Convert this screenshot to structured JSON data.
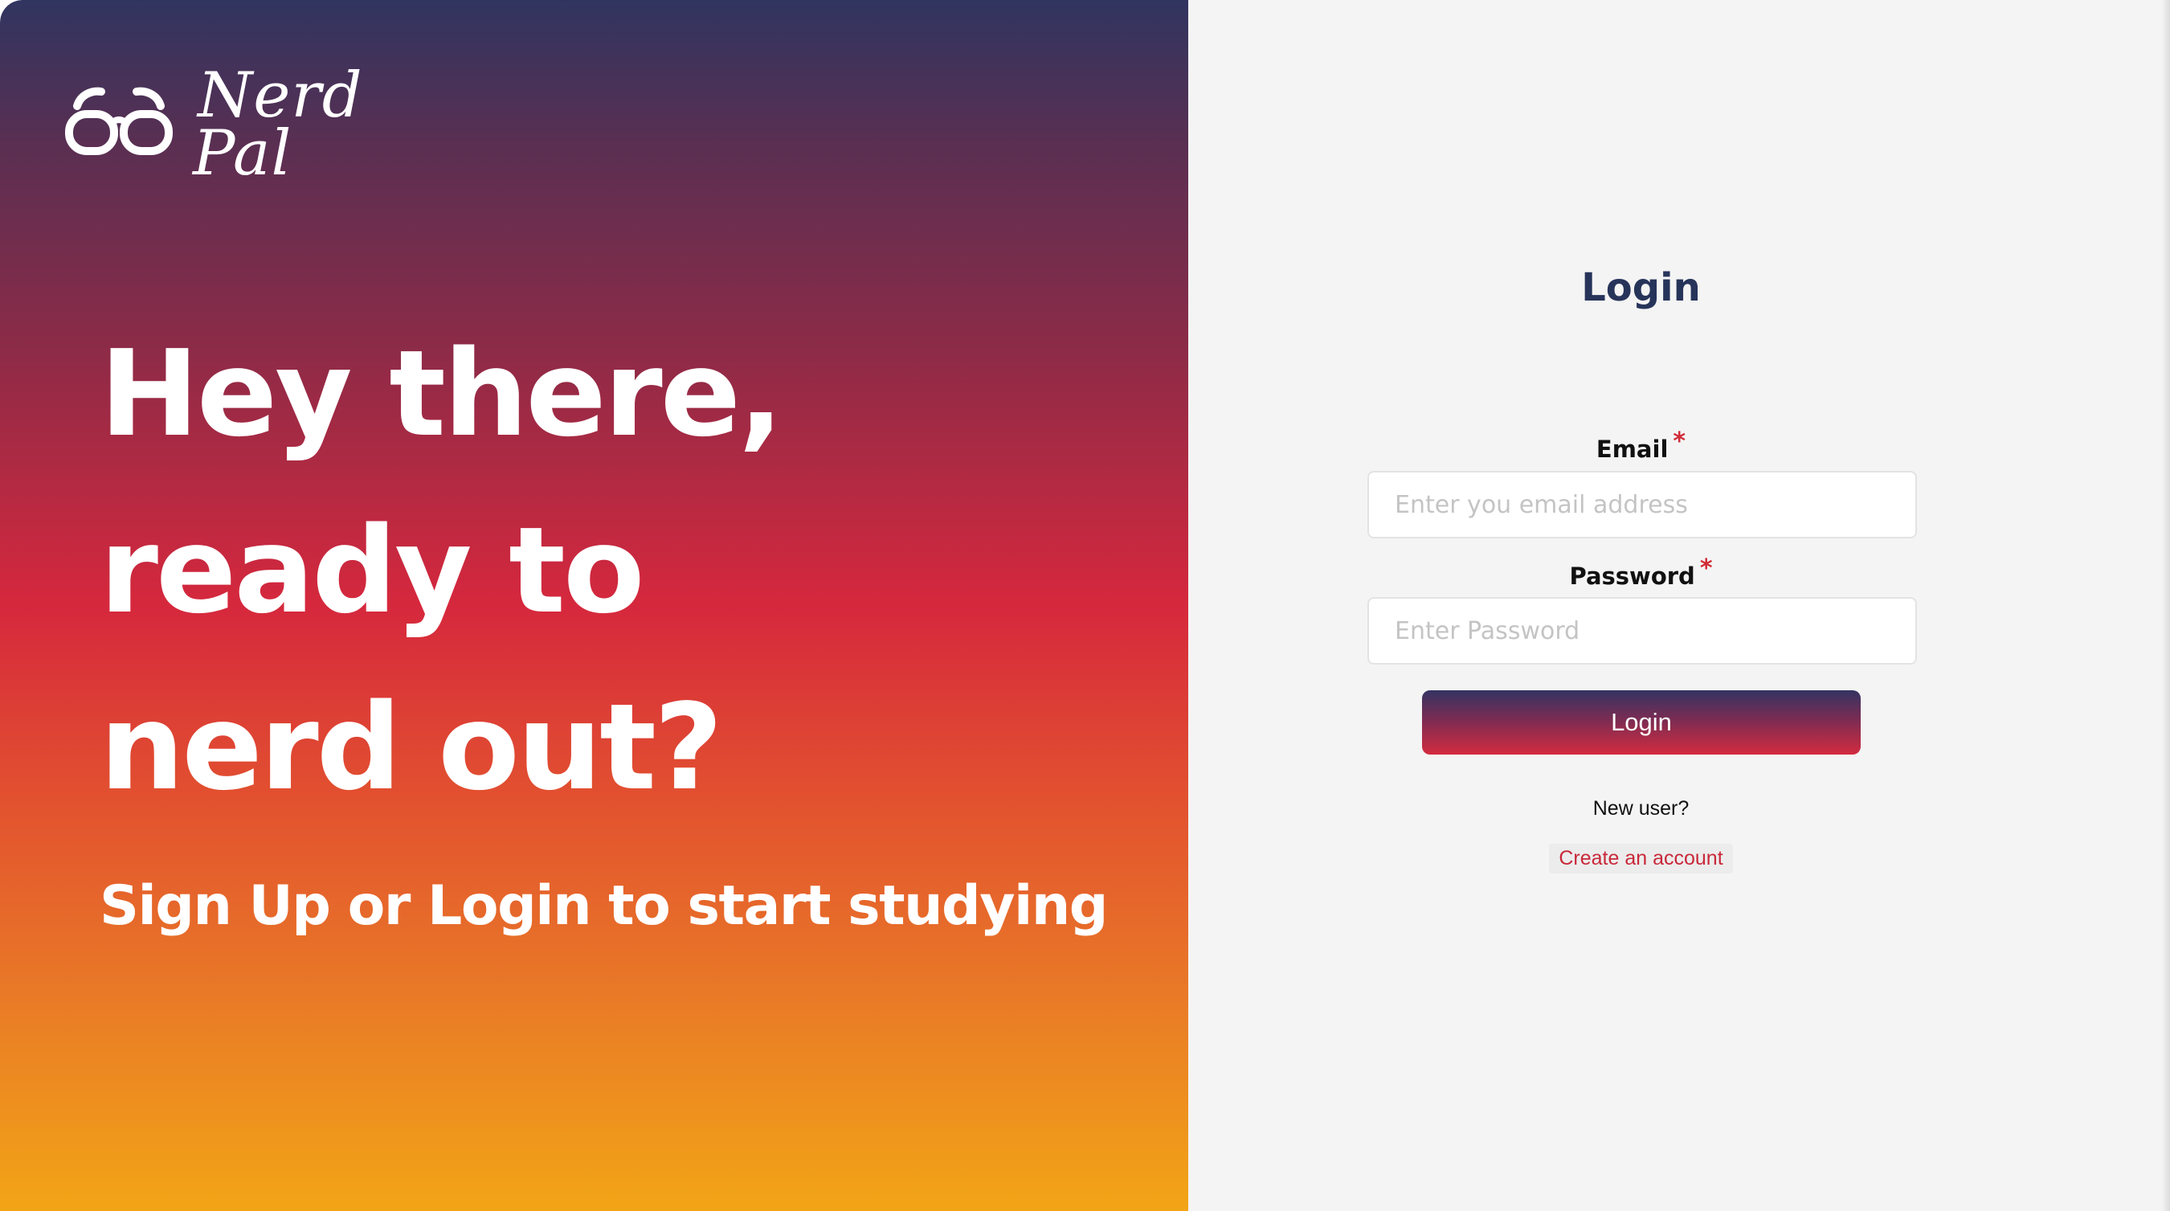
{
  "brand": {
    "logo_line1": "Nerd",
    "logo_line2": "Pal",
    "logo_icon": "glasses-icon"
  },
  "hero": {
    "headline_lines": [
      "Hey there,",
      "ready to",
      "nerd out?"
    ],
    "tagline": "Sign Up or Login to start studying"
  },
  "form": {
    "title": "Login",
    "email": {
      "label": "Email",
      "required_mark": "*",
      "placeholder": "Enter you email address",
      "value": ""
    },
    "password": {
      "label": "Password",
      "required_mark": "*",
      "placeholder": "Enter Password",
      "value": ""
    },
    "submit_label": "Login",
    "new_user_text": "New user?",
    "create_account_link": "Create an account"
  },
  "colors": {
    "gradient_top": "#303560",
    "gradient_mid": "#d6283d",
    "gradient_bottom": "#f2a516",
    "title_color": "#27345a",
    "required_color": "#d12a36",
    "link_color": "#c8283a",
    "panel_background": "#f4f4f4"
  }
}
